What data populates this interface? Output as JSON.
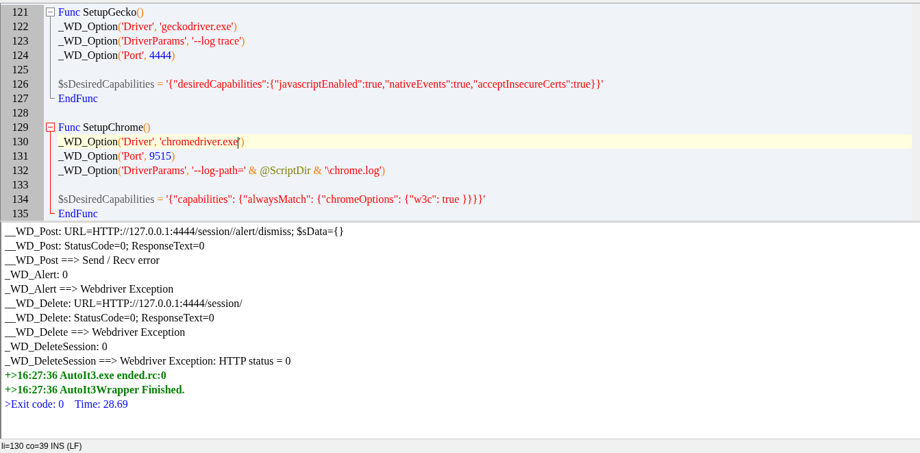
{
  "editor": {
    "segments": [
      {
        "kind": "fold",
        "active": false,
        "lines": [
          {
            "number": "121",
            "current": false,
            "tokens": [
              {
                "kind": "keyword",
                "text": "Func "
              },
              {
                "kind": "plain",
                "text": "SetupGecko"
              },
              {
                "kind": "operator",
                "text": "()"
              }
            ]
          },
          {
            "number": "122",
            "current": false,
            "tokens": [
              {
                "kind": "plain",
                "text": "_WD_Option"
              },
              {
                "kind": "operator",
                "text": "("
              },
              {
                "kind": "string",
                "text": "'Driver'"
              },
              {
                "kind": "operator",
                "text": ", "
              },
              {
                "kind": "string",
                "text": "'geckodriver.exe'"
              },
              {
                "kind": "operator",
                "text": ")"
              }
            ]
          },
          {
            "number": "123",
            "current": false,
            "tokens": [
              {
                "kind": "plain",
                "text": "_WD_Option"
              },
              {
                "kind": "operator",
                "text": "("
              },
              {
                "kind": "string",
                "text": "'DriverParams'"
              },
              {
                "kind": "operator",
                "text": ", "
              },
              {
                "kind": "string",
                "text": "'--log trace'"
              },
              {
                "kind": "operator",
                "text": ")"
              }
            ]
          },
          {
            "number": "124",
            "current": false,
            "tokens": [
              {
                "kind": "plain",
                "text": "_WD_Option"
              },
              {
                "kind": "operator",
                "text": "("
              },
              {
                "kind": "string",
                "text": "'Port'"
              },
              {
                "kind": "operator",
                "text": ", "
              },
              {
                "kind": "number",
                "text": "4444"
              },
              {
                "kind": "operator",
                "text": ")"
              }
            ]
          },
          {
            "number": "125",
            "current": false
          },
          {
            "number": "126",
            "current": false,
            "tokens": [
              {
                "kind": "variable",
                "text": "$sDesiredCapabilities "
              },
              {
                "kind": "operator",
                "text": "= "
              },
              {
                "kind": "string",
                "text": "'{\"desiredCapabilities\":{\"javascriptEnabled\":true,\"nativeEvents\":true,\"acceptInsecureCerts\":true}}'"
              }
            ]
          },
          {
            "number": "127",
            "current": false,
            "tokens": [
              {
                "kind": "keyword",
                "text": "EndFunc"
              }
            ]
          }
        ]
      },
      {
        "kind": "plain",
        "lines": [
          {
            "number": "128",
            "current": false
          }
        ]
      },
      {
        "kind": "fold",
        "active": true,
        "lines": [
          {
            "number": "129",
            "current": false,
            "tokens": [
              {
                "kind": "keyword",
                "text": "Func "
              },
              {
                "kind": "plain",
                "text": "SetupChrome"
              },
              {
                "kind": "operator",
                "text": "()"
              }
            ]
          },
          {
            "number": "130",
            "current": true,
            "tokens": [
              {
                "kind": "plain",
                "text": "_WD_Option"
              },
              {
                "kind": "operator",
                "text": "("
              },
              {
                "kind": "string",
                "text": "'Driver'"
              },
              {
                "kind": "operator",
                "text": ", "
              },
              {
                "kind": "string",
                "text": "'chromedriver.exe",
                "caret_after": true
              },
              {
                "kind": "string",
                "text": "'"
              },
              {
                "kind": "operator",
                "text": ")"
              }
            ]
          },
          {
            "number": "131",
            "current": false,
            "tokens": [
              {
                "kind": "plain",
                "text": "_WD_Option"
              },
              {
                "kind": "operator",
                "text": "("
              },
              {
                "kind": "string",
                "text": "'Port'"
              },
              {
                "kind": "operator",
                "text": ", "
              },
              {
                "kind": "number",
                "text": "9515"
              },
              {
                "kind": "operator",
                "text": ")"
              }
            ]
          },
          {
            "number": "132",
            "current": false,
            "tokens": [
              {
                "kind": "plain",
                "text": "_WD_Option"
              },
              {
                "kind": "operator",
                "text": "("
              },
              {
                "kind": "string",
                "text": "'DriverParams'"
              },
              {
                "kind": "operator",
                "text": ", "
              },
              {
                "kind": "string",
                "text": "'--log-path='"
              },
              {
                "kind": "operator",
                "text": " & "
              },
              {
                "kind": "macro",
                "text": "@ScriptDir"
              },
              {
                "kind": "operator",
                "text": " & "
              },
              {
                "kind": "string",
                "text": "'\\chrome.log'"
              },
              {
                "kind": "operator",
                "text": ")"
              }
            ]
          },
          {
            "number": "133",
            "current": false
          },
          {
            "number": "134",
            "current": false,
            "tokens": [
              {
                "kind": "variable",
                "text": "$sDesiredCapabilities "
              },
              {
                "kind": "operator",
                "text": "= "
              },
              {
                "kind": "string",
                "text": "'{\"capabilities\": {\"alwaysMatch\": {\"chromeOptions\": {\"w3c\": true }}}}'"
              }
            ]
          },
          {
            "number": "135",
            "current": false,
            "tokens": [
              {
                "kind": "keyword",
                "text": "EndFunc"
              }
            ]
          }
        ]
      }
    ]
  },
  "output": {
    "lines": [
      {
        "kind": "normal",
        "text": "__WD_Post: URL=HTTP://127.0.0.1:4444/session//alert/dismiss; $sData={}"
      },
      {
        "kind": "normal",
        "text": "__WD_Post: StatusCode=0; ResponseText=0"
      },
      {
        "kind": "normal",
        "text": "__WD_Post ==> Send / Recv error"
      },
      {
        "kind": "normal",
        "text": "_WD_Alert: 0"
      },
      {
        "kind": "normal",
        "text": "_WD_Alert ==> Webdriver Exception"
      },
      {
        "kind": "normal",
        "text": "__WD_Delete: URL=HTTP://127.0.0.1:4444/session/"
      },
      {
        "kind": "normal",
        "text": "__WD_Delete: StatusCode=0; ResponseText=0"
      },
      {
        "kind": "normal",
        "text": "__WD_Delete ==> Webdriver Exception"
      },
      {
        "kind": "normal",
        "text": "_WD_DeleteSession: 0"
      },
      {
        "kind": "normal",
        "text": "_WD_DeleteSession ==> Webdriver Exception: HTTP status = 0"
      },
      {
        "kind": "success",
        "text": "+>16:27:36 AutoIt3.exe ended.rc:0"
      },
      {
        "kind": "success",
        "text": "+>16:27:36 AutoIt3Wrapper Finished."
      },
      {
        "kind": "info",
        "text": ">Exit code: 0    Time: 28.69"
      }
    ]
  },
  "status_bar": {
    "text": "li=130 co=39 INS (LF)"
  }
}
